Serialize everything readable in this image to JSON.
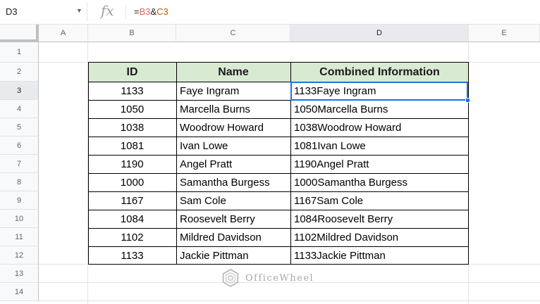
{
  "formula_bar": {
    "cell_ref": "D3",
    "fx": "fx",
    "formula_prefix": "=",
    "formula_ref1": "B3",
    "formula_op": "&",
    "formula_ref2": "C3"
  },
  "columns": [
    "A",
    "B",
    "C",
    "D",
    "E"
  ],
  "rows": [
    "1",
    "2",
    "3",
    "4",
    "5",
    "6",
    "7",
    "8",
    "9",
    "10",
    "11",
    "12",
    "13",
    "14"
  ],
  "table": {
    "headers": [
      "ID",
      "Name",
      "Combined Information"
    ],
    "rows": [
      [
        "1133",
        "Faye Ingram",
        "1133Faye Ingram"
      ],
      [
        "1050",
        "Marcella Burns",
        "1050Marcella Burns"
      ],
      [
        "1038",
        "Woodrow Howard",
        "1038Woodrow Howard"
      ],
      [
        "1081",
        "Ivan Lowe",
        "1081Ivan Lowe"
      ],
      [
        "1190",
        "Angel Pratt",
        "1190Angel Pratt"
      ],
      [
        "1000",
        "Samantha Burgess",
        "1000Samantha Burgess"
      ],
      [
        "1167",
        "Sam Cole",
        "1167Sam Cole"
      ],
      [
        "1084",
        "Roosevelt Berry",
        "1084Roosevelt Berry"
      ],
      [
        "1102",
        "Mildred Davidson",
        "1102Mildred Davidson"
      ],
      [
        "1133",
        "Jackie Pittman",
        "1133Jackie Pittman"
      ]
    ]
  },
  "watermark": "OfficeWheel",
  "colors": {
    "header_fill": "#d9ead3",
    "selection": "#1a73e8"
  }
}
